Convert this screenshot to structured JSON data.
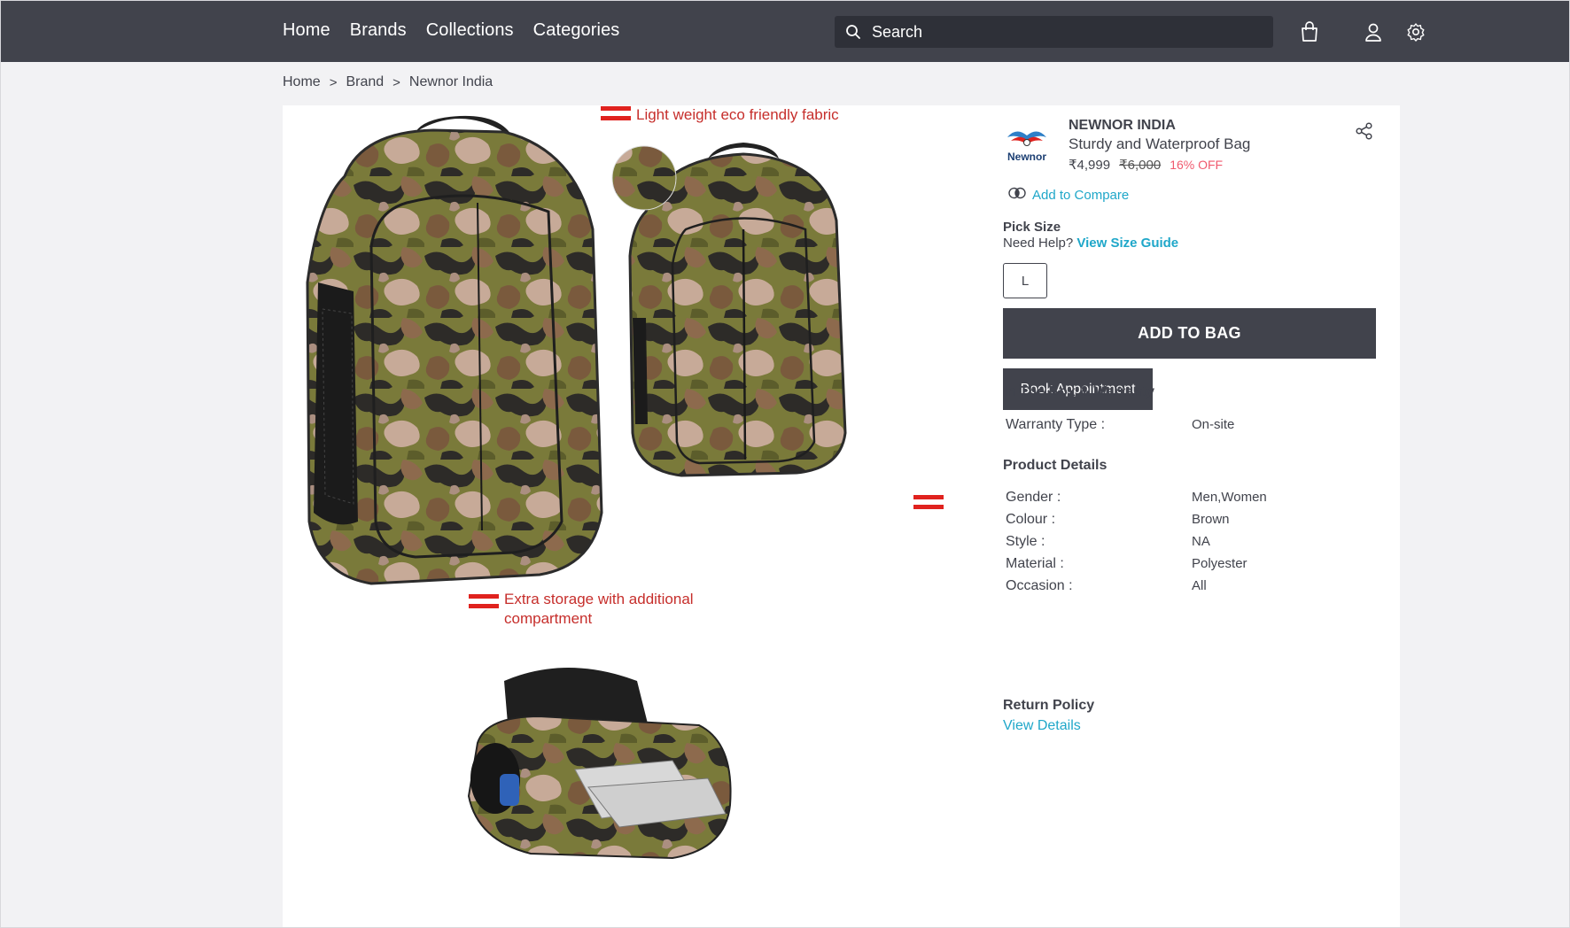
{
  "header": {
    "nav": [
      {
        "label": "Home"
      },
      {
        "label": "Brands"
      },
      {
        "label": "Collections"
      },
      {
        "label": "Categories"
      }
    ],
    "search": {
      "placeholder": "Search"
    },
    "icons": [
      "search-icon",
      "bag-icon",
      "user-icon",
      "settings-icon"
    ]
  },
  "breadcrumb": [
    "Home",
    "Brand",
    "Newnor India"
  ],
  "gallery": {
    "callouts": {
      "fabric": "Light  weight eco friendly fabric",
      "storage_line1": "Extra storage with additional",
      "storage_line2": "compartment"
    },
    "logo_text": "Newnor"
  },
  "product": {
    "brand": "NEWNOR INDIA",
    "name": "Sturdy and Waterproof Bag",
    "price": "₹4,999",
    "mrp": "₹6,000",
    "discount": "16% OFF",
    "compare_label": "Add to Compare",
    "pick_size_label": "Pick Size",
    "need_help": "Need Help?",
    "size_guide": "View Size Guide",
    "selected_size": "L",
    "add_to_bag": "ADD TO BAG",
    "book_appointment": "Book Appointment"
  },
  "warranty": {
    "title": "In The Box & Warranty",
    "rows": [
      {
        "key": "Warranty Type :",
        "value": "On-site"
      }
    ]
  },
  "details": {
    "title": "Product Details",
    "rows": [
      {
        "key": "Gender :",
        "value": "Men,Women"
      },
      {
        "key": "Colour :",
        "value": "Brown"
      },
      {
        "key": "Style :",
        "value": "NA"
      },
      {
        "key": "Material :",
        "value": "Polyester"
      },
      {
        "key": "Occasion :",
        "value": "All"
      }
    ]
  },
  "return_policy": {
    "title": "Return Policy",
    "link": "View Details"
  },
  "colors": {
    "header_bg": "#41434c",
    "accent_link": "#1fa7c9",
    "discount": "#f05a6e",
    "callout_red": "#c62e2b"
  }
}
